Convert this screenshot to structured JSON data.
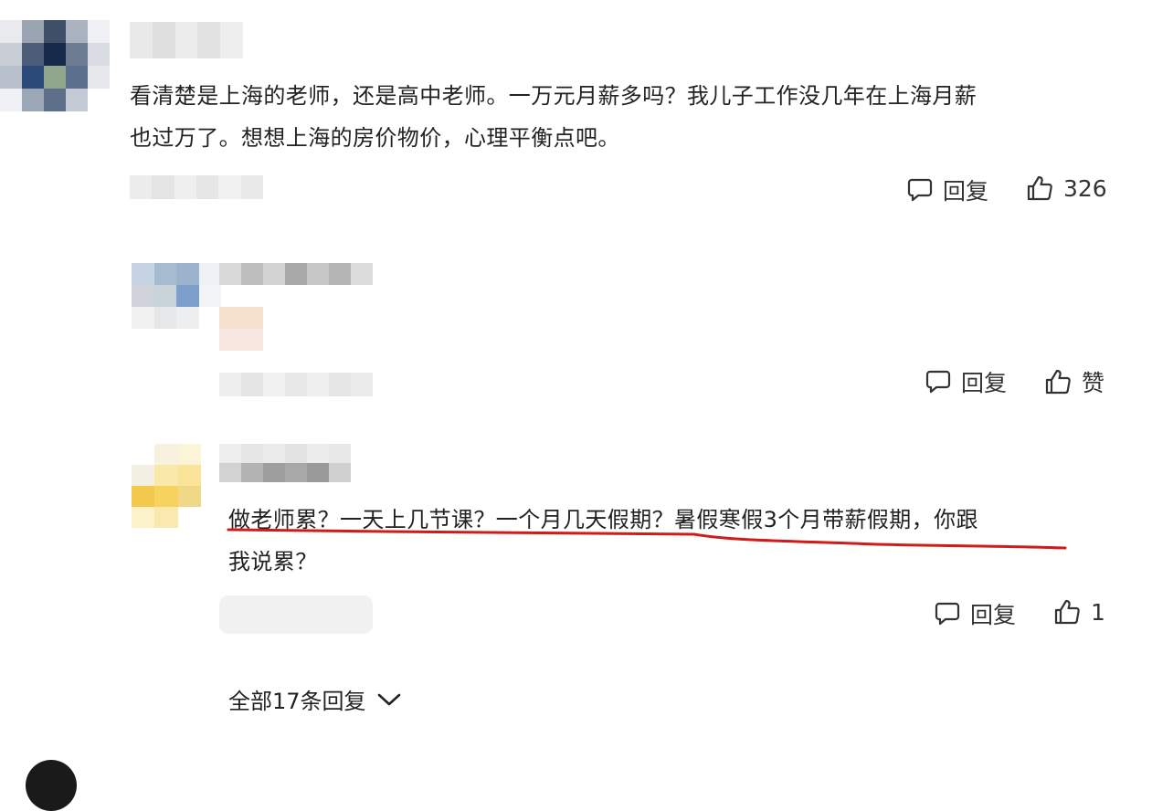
{
  "comments": [
    {
      "text_lines": [
        "看清楚是上海的老师，还是高中老师。一万元月薪多吗？我儿子工作没几年在上海月薪",
        "也过万了。想想上海的房价物价，心理平衡点吧。"
      ],
      "reply_label": "回复",
      "like_label": "326"
    },
    {
      "text_lines": [],
      "reply_label": "回复",
      "like_label": "赞"
    },
    {
      "text_lines": [
        "做老师累？一天上几节课？一个月几天假期？暑假寒假3个月带薪假期，你跟",
        "我说累？"
      ],
      "reply_label": "回复",
      "like_label": "1"
    }
  ],
  "view_all_replies": "全部17条回复",
  "icons": {
    "reply": "comment-bubble-icon",
    "like": "thumbs-up-icon",
    "expand": "chevron-down-icon"
  },
  "colors": {
    "annotation_underline": "#d11a1a",
    "text": "#222222",
    "action_text": "#333333"
  }
}
